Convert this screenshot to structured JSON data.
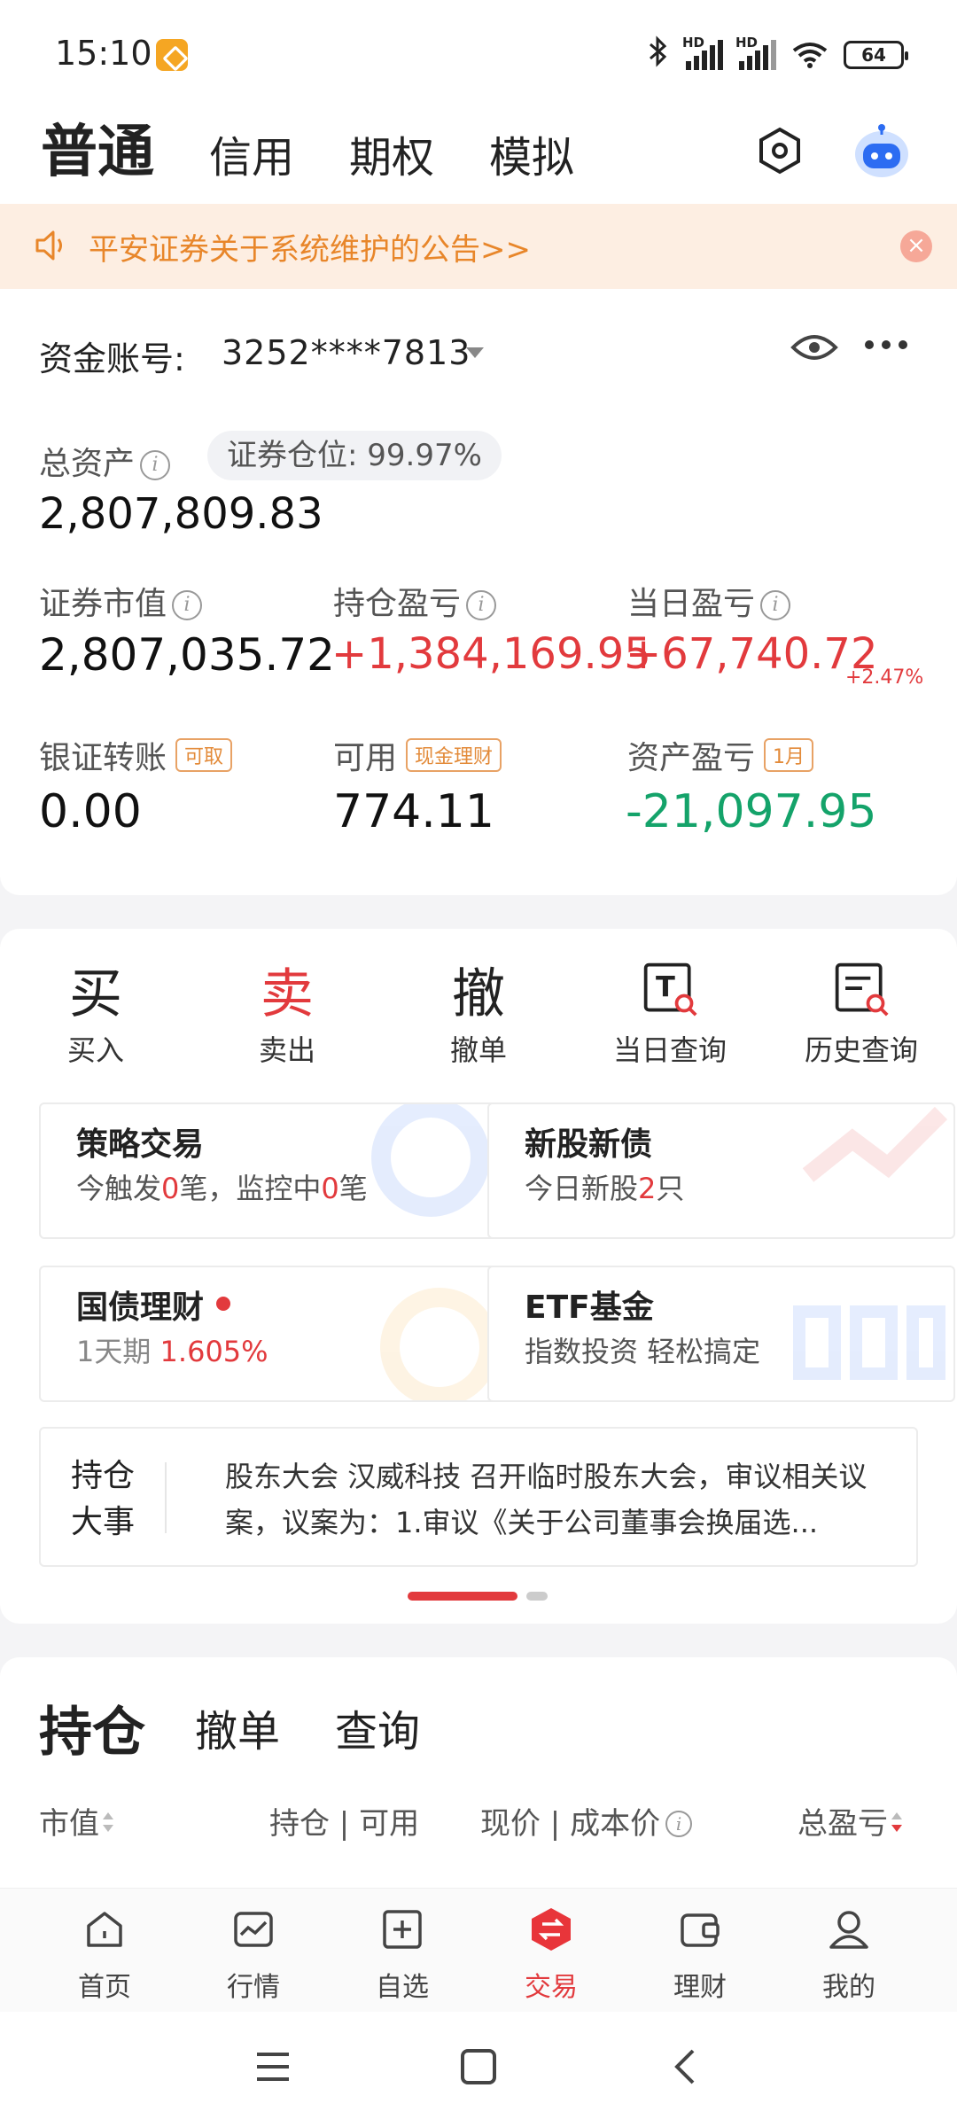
{
  "status_bar": {
    "time": "15:10",
    "battery": "64",
    "signal_label_1": "HD",
    "signal_label_2": "HD"
  },
  "top_tabs": [
    {
      "label": "普通",
      "active": true
    },
    {
      "label": "信用"
    },
    {
      "label": "期权"
    },
    {
      "label": "模拟"
    }
  ],
  "notice": {
    "text": "平安证券关于系统维护的公告>>",
    "icon": "speaker-icon"
  },
  "account": {
    "label": "资金账号:",
    "number": "3252****7813",
    "total_assets_label": "总资产",
    "position_label": "证券仓位:",
    "position_value": "99.97%",
    "total_assets": "2,807,809.83",
    "market_value_label": "证券市值",
    "market_value": "2,807,035.72",
    "holding_pnl_label": "持仓盈亏",
    "holding_pnl": "+1,384,169.95",
    "day_pnl_label": "当日盈亏",
    "day_pnl": "+67,740.72",
    "day_pnl_pct": "+2.47%",
    "transfer_label": "银证转账",
    "transfer_tag": "可取",
    "transfer_value": "0.00",
    "available_label": "可用",
    "available_tag": "现金理财",
    "available_value": "774.11",
    "asset_pnl_label": "资产盈亏",
    "asset_pnl_tag": "1月",
    "asset_pnl": "-21,097.95",
    "colors": {
      "up": "#e23a3d",
      "down": "#14a36a"
    }
  },
  "functions": [
    {
      "icon": "买",
      "label": "买入"
    },
    {
      "icon": "卖",
      "label": "卖出"
    },
    {
      "icon": "撤",
      "label": "撤单"
    },
    {
      "icon": "today-query-icon",
      "label": "当日查询"
    },
    {
      "icon": "history-query-icon",
      "label": "历史查询"
    }
  ],
  "tiles": {
    "strategy": {
      "title": "策略交易",
      "sub_a": "今触发",
      "count_a": "0",
      "sub_b": "笔，监控中",
      "count_b": "0",
      "sub_c": "笔"
    },
    "ipo": {
      "title": "新股新债",
      "sub_a": "今日新股",
      "count": "2",
      "sub_b": "只"
    },
    "bond": {
      "title": "国债理财",
      "sub_a": "1天期",
      "rate": "1.605%"
    },
    "etf": {
      "title": "ETF基金",
      "sub": "指数投资 轻松搞定"
    }
  },
  "news": {
    "header": "持仓大事",
    "text": "股东大会 汉威科技 召开临时股东大会，审议相关议案，议案为：1.审议《关于公司董事会换届选..."
  },
  "holdings": {
    "tabs": [
      "持仓",
      "撤单",
      "查询"
    ],
    "col_market_value": "市值",
    "col_position": "持仓 | 可用",
    "col_price": "现价 | 成本价",
    "col_total_pnl": "总盈亏"
  },
  "bottom_nav": [
    {
      "label": "首页",
      "icon": "home-icon"
    },
    {
      "label": "行情",
      "icon": "chart-icon"
    },
    {
      "label": "自选",
      "icon": "plus-box-icon"
    },
    {
      "label": "交易",
      "icon": "trade-icon",
      "active": true
    },
    {
      "label": "理财",
      "icon": "wallet-icon"
    },
    {
      "label": "我的",
      "icon": "user-icon"
    }
  ]
}
